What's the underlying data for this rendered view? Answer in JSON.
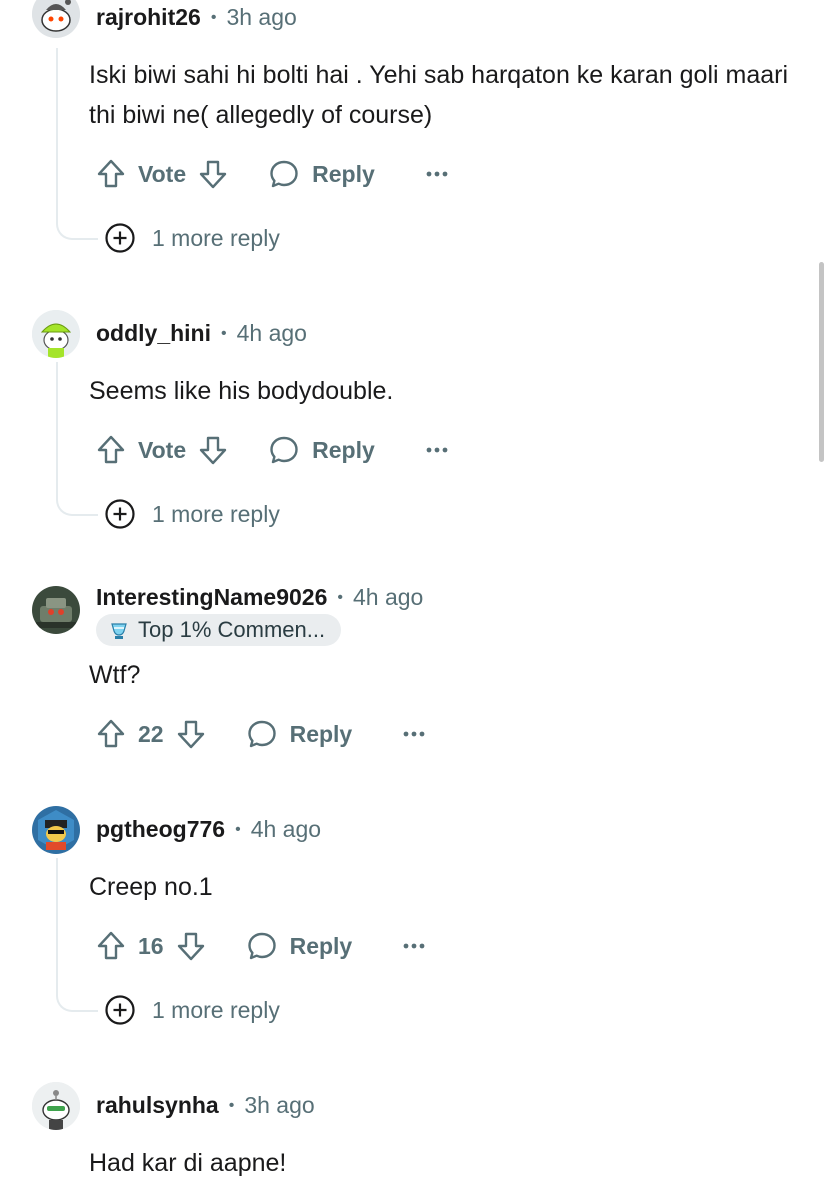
{
  "comments": [
    {
      "username": "rajrohit26",
      "time": "3h ago",
      "body": "Iski biwi sahi hi bolti hai . Yehi sab harqaton ke karan goli maari thi biwi ne( allegedly of course)",
      "vote_label": "Vote",
      "reply_label": "Reply",
      "more_replies": "1 more reply"
    },
    {
      "username": "oddly_hini",
      "time": "4h ago",
      "body": "Seems like his bodydouble.",
      "vote_label": "Vote",
      "reply_label": "Reply",
      "more_replies": "1 more reply"
    },
    {
      "username": "InterestingName9026",
      "time": "4h ago",
      "flair": "Top 1% Commen...",
      "body": "Wtf?",
      "vote_label": "22",
      "reply_label": "Reply"
    },
    {
      "username": "pgtheog776",
      "time": "4h ago",
      "body": "Creep no.1",
      "vote_label": "16",
      "reply_label": "Reply",
      "more_replies": "1 more reply"
    },
    {
      "username": "rahulsynha",
      "time": "3h ago",
      "body": "Had kar di aapne!"
    }
  ],
  "separator": "•",
  "icons": {
    "upvote": "upvote-arrow-icon",
    "downvote": "downvote-arrow-icon",
    "reply": "speech-bubble-icon",
    "more": "ellipsis-icon",
    "expand": "plus-circle-icon",
    "flair": "trophy-icon"
  },
  "colors": {
    "text_primary": "#1a1a1b",
    "text_secondary": "#576f76",
    "thread_line": "#e5ebee",
    "flair_bg": "#eaedef"
  }
}
